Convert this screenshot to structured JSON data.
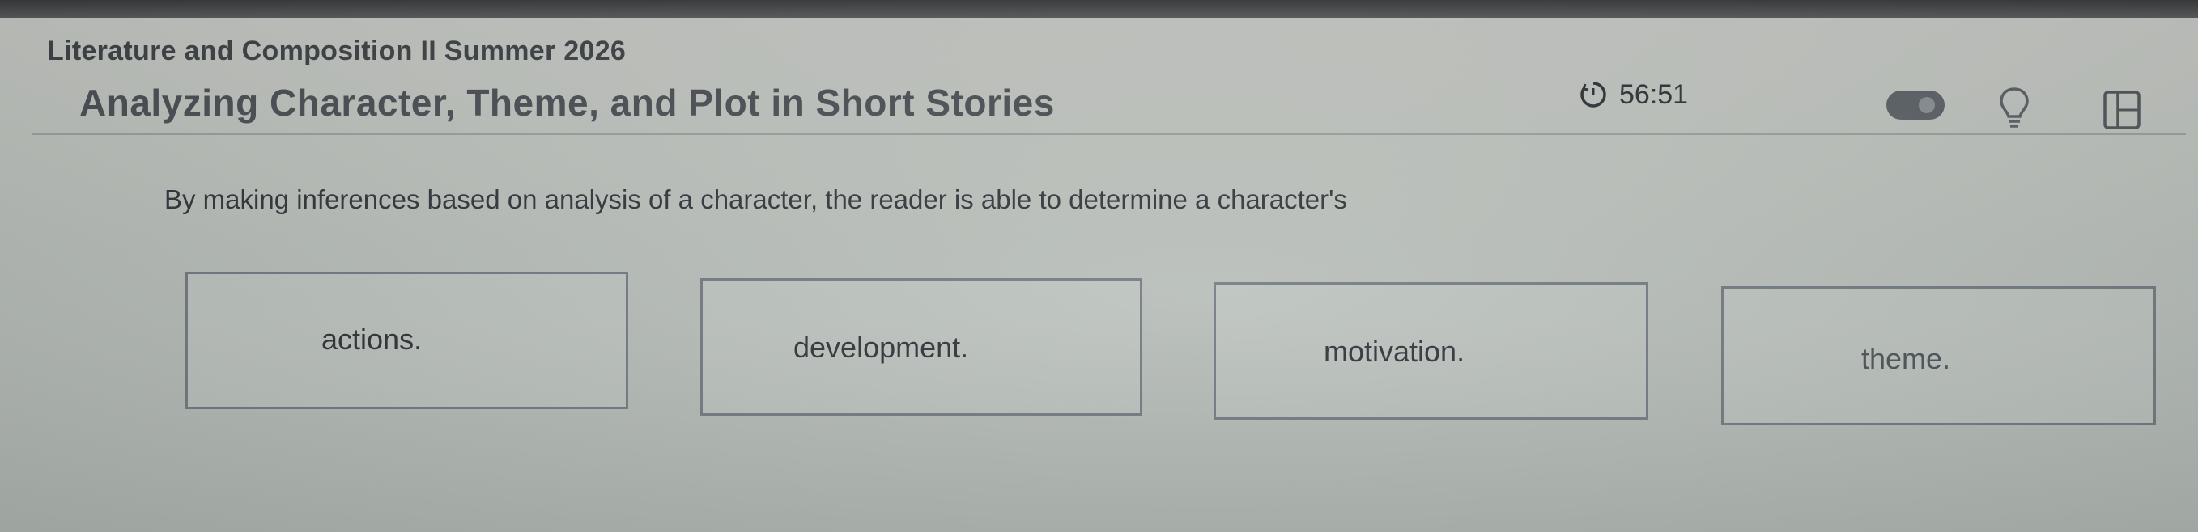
{
  "course": {
    "title": "Literature and Composition II Summer 2026"
  },
  "lesson": {
    "title": "Analyzing Character, Theme, and Plot in Short Stories"
  },
  "timer": {
    "icon": "timer-icon",
    "value": "56:51"
  },
  "toolbar": {
    "toggle_icon": "toggle-switch",
    "hint_icon": "lightbulb-icon",
    "panel_icon": "side-panel-icon"
  },
  "question": {
    "text": "By making inferences based on analysis of a character, the reader is able to determine a character's"
  },
  "options": [
    {
      "label": "actions."
    },
    {
      "label": "development."
    },
    {
      "label": "motivation."
    },
    {
      "label": "theme."
    }
  ],
  "colors": {
    "background": "#bfc4bf",
    "border": "#6f787e",
    "text": "#2b2f33"
  }
}
